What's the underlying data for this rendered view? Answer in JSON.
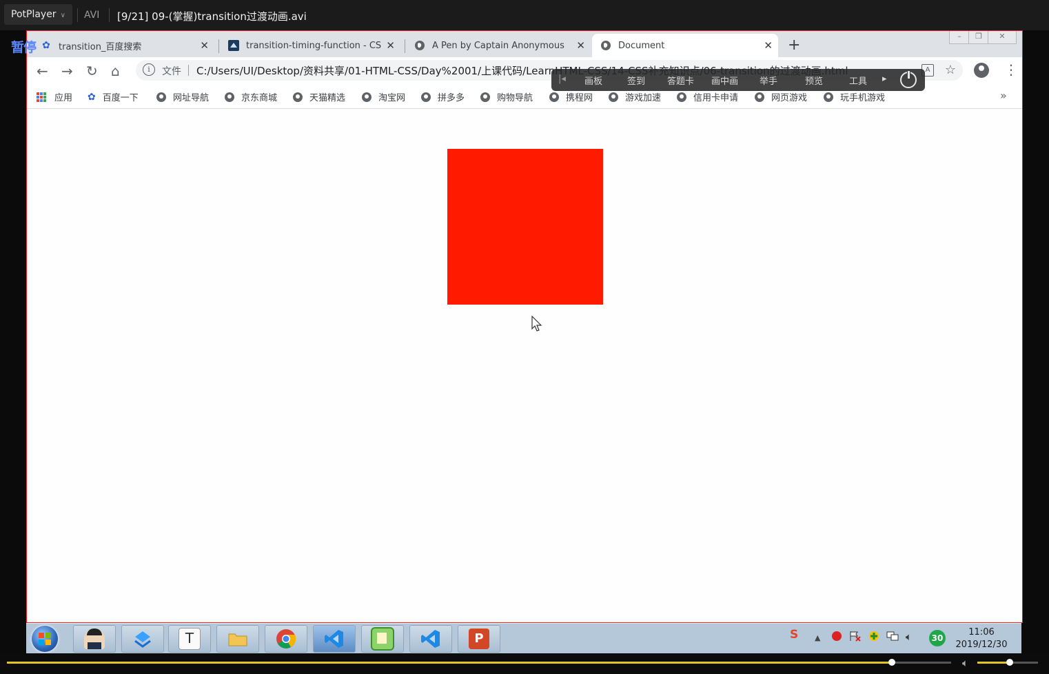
{
  "player": {
    "brand": "PotPlayer",
    "format": "AVI",
    "file_title": "[9/21] 09-(掌握)transition过渡动画.avi",
    "state_label": "暂停",
    "seek_progress": 0.937,
    "volume_level": 0.53,
    "accent_color": "#e3c623"
  },
  "browser": {
    "tabs": [
      {
        "title": "transition_百度搜索",
        "icon": "baidu-paw-icon",
        "active": false
      },
      {
        "title": "transition-timing-function - CSS",
        "icon": "mdn-icon",
        "active": false
      },
      {
        "title": "A Pen by Captain Anonymous",
        "icon": "globe-icon",
        "active": false
      },
      {
        "title": "Document",
        "icon": "globe-icon",
        "active": true
      }
    ],
    "address": {
      "scheme_label": "文件",
      "url": "C:/Users/UI/Desktop/资料共享/01-HTML-CSS/Day%2001/上课代码/LearnHTML-CSS/14-CSS补充知识点/06-transition的过渡动画.html"
    },
    "bookmarks": [
      {
        "label": "应用",
        "icon": "apps-grid-icon"
      },
      {
        "label": "百度一下",
        "icon": "baidu-paw-icon"
      },
      {
        "label": "网址导航",
        "icon": "globe-icon"
      },
      {
        "label": "京东商城",
        "icon": "globe-icon"
      },
      {
        "label": "天猫精选",
        "icon": "globe-icon"
      },
      {
        "label": "淘宝网",
        "icon": "globe-icon"
      },
      {
        "label": "拼多多",
        "icon": "globe-icon"
      },
      {
        "label": "购物导航",
        "icon": "globe-icon"
      },
      {
        "label": "携程网",
        "icon": "globe-icon"
      },
      {
        "label": "游戏加速",
        "icon": "globe-icon"
      },
      {
        "label": "信用卡申请",
        "icon": "globe-icon"
      },
      {
        "label": "网页游戏",
        "icon": "globe-icon"
      },
      {
        "label": "玩手机游戏",
        "icon": "globe-icon"
      }
    ],
    "more_bookmarks": "»"
  },
  "overlay_toolbar": {
    "items": [
      "画板",
      "签到",
      "答题卡",
      "画中画",
      "举手",
      "预览",
      "工具"
    ]
  },
  "page": {
    "box_color": "#ff1a00"
  },
  "taskbar": {
    "apps": [
      {
        "name": "avatar-app",
        "icon": "person-avatar-icon"
      },
      {
        "name": "app-arrows",
        "icon": "blue-arrows-icon"
      },
      {
        "name": "typora",
        "icon": "typora-t-icon"
      },
      {
        "name": "explorer",
        "icon": "folder-icon"
      },
      {
        "name": "chrome",
        "icon": "chrome-icon"
      },
      {
        "name": "vscode-1",
        "icon": "vscode-icon"
      },
      {
        "name": "notepad",
        "icon": "notepad-icon"
      },
      {
        "name": "vscode-2",
        "icon": "vscode-icon"
      },
      {
        "name": "powerpoint",
        "icon": "powerpoint-icon"
      }
    ],
    "tray_badge": "30",
    "clock_time": "11:06",
    "clock_date": "2019/12/30"
  }
}
